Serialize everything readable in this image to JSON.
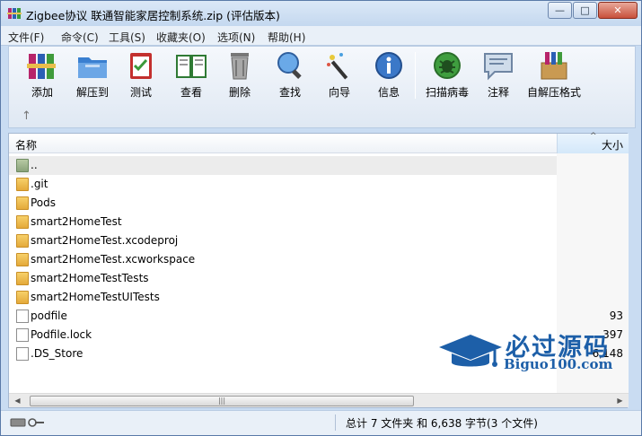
{
  "window": {
    "title": "Zigbee协议 联通智能家居控制系统.zip (评估版本)",
    "buttons": {
      "minimize": "—",
      "maximize": "□",
      "close": "✕"
    }
  },
  "menu": [
    "文件(F)",
    "命令(C)",
    "工具(S)",
    "收藏夹(O)",
    "选项(N)",
    "帮助(H)"
  ],
  "toolbar": [
    {
      "label": "添加",
      "icon": "add-books-icon"
    },
    {
      "label": "解压到",
      "icon": "extract-folder-icon"
    },
    {
      "label": "测试",
      "icon": "test-clipboard-icon"
    },
    {
      "label": "查看",
      "icon": "view-book-icon"
    },
    {
      "label": "删除",
      "icon": "trash-icon"
    },
    {
      "label": "查找",
      "icon": "magnifier-icon"
    },
    {
      "label": "向导",
      "icon": "wizard-wand-icon"
    },
    {
      "label": "信息",
      "icon": "info-icon"
    },
    {
      "label": "扫描病毒",
      "icon": "virus-scan-icon"
    },
    {
      "label": "注释",
      "icon": "comment-icon"
    },
    {
      "label": "自解压格式",
      "icon": "sfx-box-icon"
    }
  ],
  "up_arrow": "↑",
  "list": {
    "columns": {
      "name": "名称",
      "size": "大小"
    },
    "rows": [
      {
        "name": "..",
        "size": "",
        "kind": "parent"
      },
      {
        "name": ".git",
        "size": "",
        "kind": "folder"
      },
      {
        "name": "Pods",
        "size": "",
        "kind": "folder"
      },
      {
        "name": "smart2HomeTest",
        "size": "",
        "kind": "folder"
      },
      {
        "name": "smart2HomeTest.xcodeproj",
        "size": "",
        "kind": "folder"
      },
      {
        "name": "smart2HomeTest.xcworkspace",
        "size": "",
        "kind": "folder"
      },
      {
        "name": "smart2HomeTestTests",
        "size": "",
        "kind": "folder"
      },
      {
        "name": "smart2HomeTestUITests",
        "size": "",
        "kind": "folder"
      },
      {
        "name": "podfile",
        "size": "93",
        "kind": "file"
      },
      {
        "name": "Podfile.lock",
        "size": "397",
        "kind": "file"
      },
      {
        "name": ".DS_Store",
        "size": "6,148",
        "kind": "file"
      }
    ]
  },
  "status": {
    "text": "总计 7 文件夹 和 6,638 字节(3 个文件)"
  },
  "watermark": {
    "title": "必过源码",
    "url": "Biguo100.com"
  }
}
